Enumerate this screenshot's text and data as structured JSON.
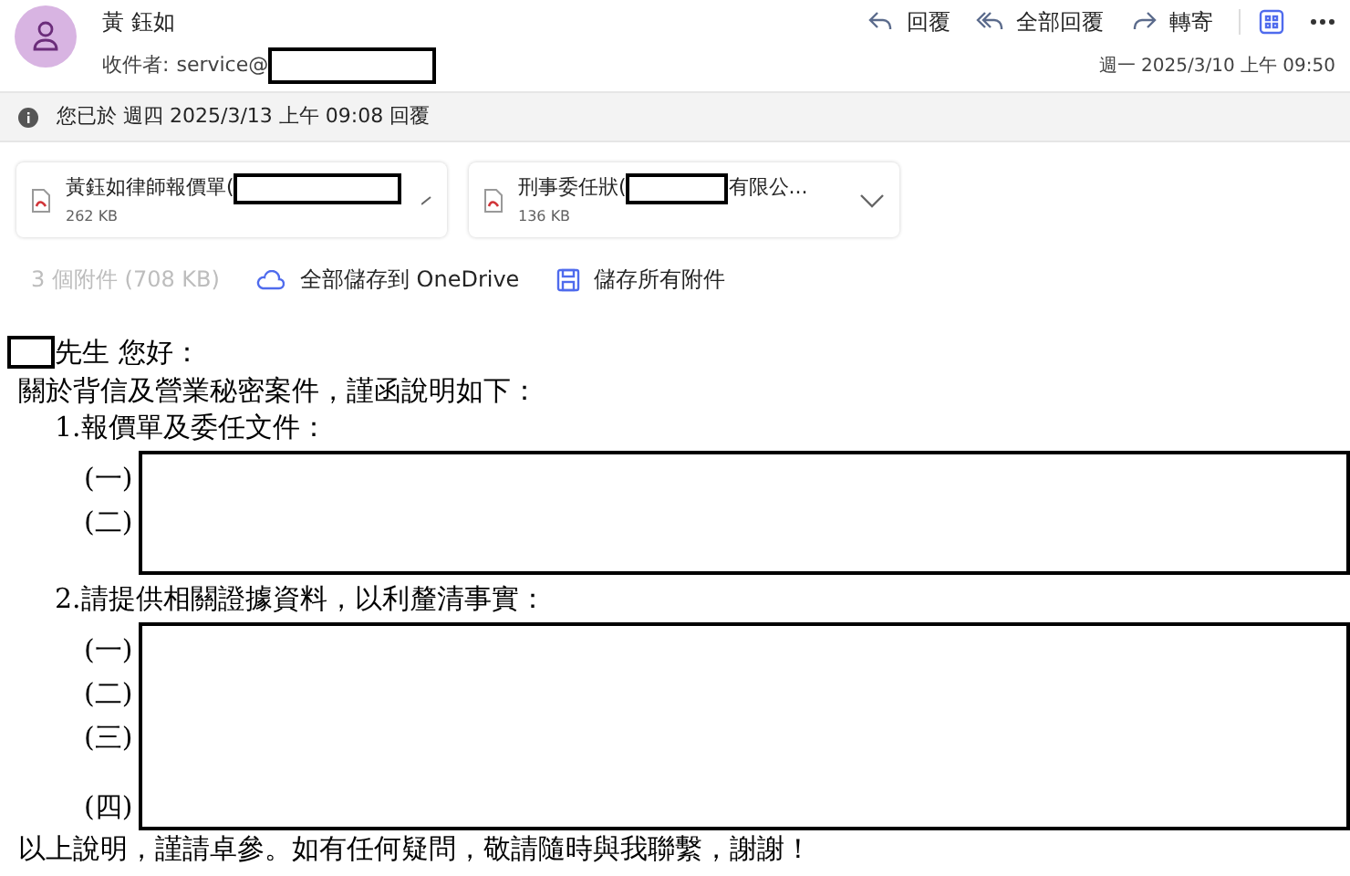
{
  "sender": {
    "name": "黃 鈺如",
    "to_label": "收件者:",
    "to_prefix": "service@",
    "date": "週一 2025/3/10 上午 09:50"
  },
  "actions": [
    {
      "kind": "reply",
      "label": "回覆"
    },
    {
      "kind": "reply_all",
      "label": "全部回覆"
    },
    {
      "kind": "forward",
      "label": "轉寄"
    },
    {
      "kind": "apps"
    },
    {
      "kind": "more"
    }
  ],
  "info_bar": {
    "text": "您已於 週四 2025/3/13 上午 09:08 回覆"
  },
  "attachments": [
    {
      "name_start": "黃鈺如律師報價單(",
      "size": "262 KB"
    },
    {
      "name_start": "刑事委任狀(",
      "name_end": "有限公...",
      "size": "136 KB"
    }
  ],
  "attachment_bar": {
    "count": "3 個附件 (708 KB)",
    "save_cloud": "全部儲存到 OneDrive",
    "save_all": "儲存所有附件"
  },
  "body": {
    "greeting": "先生 您好：",
    "intro": "關於背信及營業秘密案件，謹函說明如下：",
    "sections": [
      {
        "title": "1.報價單及委任文件：",
        "items": [
          "(一)",
          "(二)"
        ]
      },
      {
        "title": "2.請提供相關證據資料，以利釐清事實：",
        "items": [
          "(一)",
          "(二)",
          "(三)",
          "(四)"
        ]
      }
    ],
    "closing": "以上說明，謹請卓參。如有任何疑問，敬請隨時與我聯繫，謝謝！"
  }
}
